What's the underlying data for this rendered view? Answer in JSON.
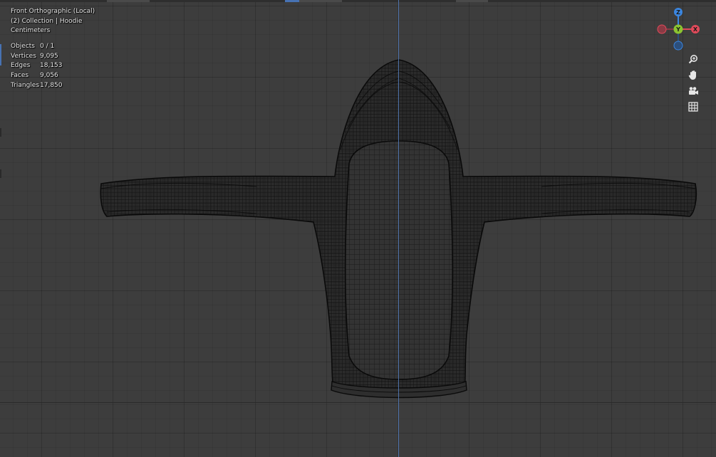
{
  "viewport": {
    "view_name": "Front Orthographic (Local)",
    "collection_info": "(2) Collection | Hoodie",
    "units": "Centimeters"
  },
  "stats": [
    {
      "label": "Objects",
      "value": "0 / 1"
    },
    {
      "label": "Vertices",
      "value": "9,095"
    },
    {
      "label": "Edges",
      "value": "18,153"
    },
    {
      "label": "Faces",
      "value": "9,056"
    },
    {
      "label": "Triangles",
      "value": "17,850"
    }
  ],
  "gizmo": {
    "z_label": "Z",
    "y_label": "Y",
    "x_label": "X",
    "colors": {
      "x": "#e04a5a",
      "y": "#8bc430",
      "z": "#3b86e0",
      "neg_x": "#8a3a44",
      "neg_z": "#2c4f7c"
    }
  },
  "nav_tools": [
    {
      "name": "zoom-icon"
    },
    {
      "name": "hand-pan-icon"
    },
    {
      "name": "camera-icon"
    },
    {
      "name": "grid-ortho-icon"
    }
  ],
  "colors": {
    "background": "#3d3d3d",
    "wire": "#0a0a0a",
    "axis_blue": "#5680c2"
  }
}
